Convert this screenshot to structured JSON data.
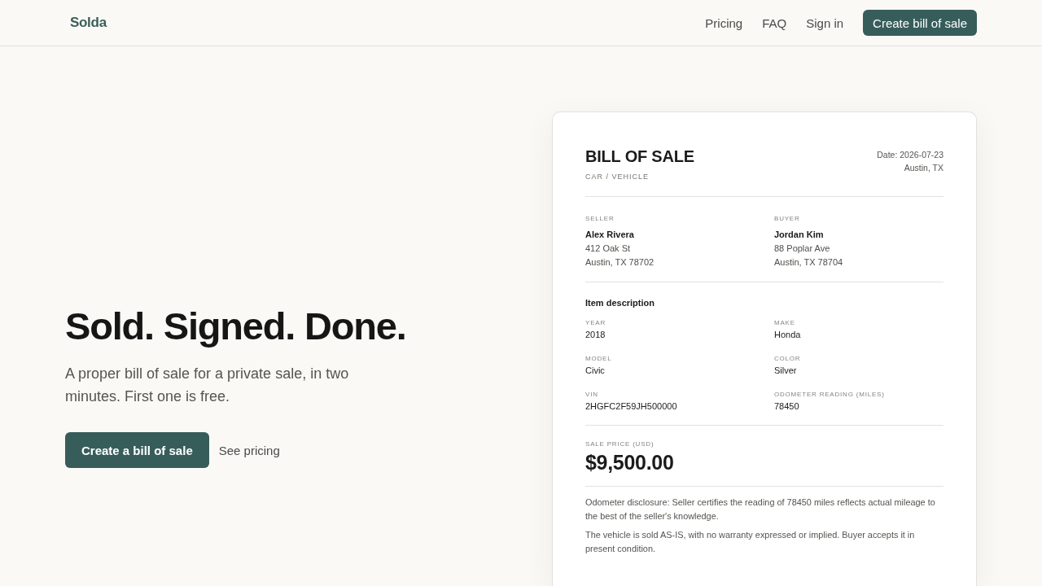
{
  "header": {
    "logo": "Solda",
    "nav": [
      "Pricing",
      "FAQ",
      "Sign in"
    ],
    "cta": "Create bill of sale"
  },
  "hero": {
    "title": "Sold. Signed. Done.",
    "subtitle": "A proper bill of sale for a private sale, in two minutes. First one is free.",
    "primary_button": "Create a bill of sale",
    "secondary_link": "See pricing"
  },
  "document": {
    "title": "BILL OF SALE",
    "category": "CAR / VEHICLE",
    "date": "Date: 2026-07-23",
    "location": "Austin, TX",
    "parties": [
      {
        "label": "SELLER",
        "name": "Alex Rivera",
        "address": [
          "412 Oak St",
          "Austin, TX 78702"
        ]
      },
      {
        "label": "BUYER",
        "name": "Jordan Kim",
        "address": [
          "88 Poplar Ave",
          "Austin, TX 78704"
        ]
      }
    ],
    "item_heading": "Item description",
    "fields": [
      {
        "label": "YEAR",
        "value": "2018"
      },
      {
        "label": "MAKE",
        "value": "Honda"
      },
      {
        "label": "MODEL",
        "value": "Civic"
      },
      {
        "label": "COLOR",
        "value": "Silver"
      },
      {
        "label": "VIN",
        "value": "2HGFC2F59JH500000"
      },
      {
        "label": "ODOMETER READING (MILES)",
        "value": "78450"
      }
    ],
    "price_label": "SALE PRICE (USD)",
    "price": "$9,500.00",
    "notes": [
      "Odometer disclosure: Seller certifies the reading of 78450 miles reflects actual mileage to the best of the seller's knowledge.",
      "The vehicle is sold AS-IS, with no warranty expressed or implied. Buyer accepts it in present condition."
    ]
  }
}
